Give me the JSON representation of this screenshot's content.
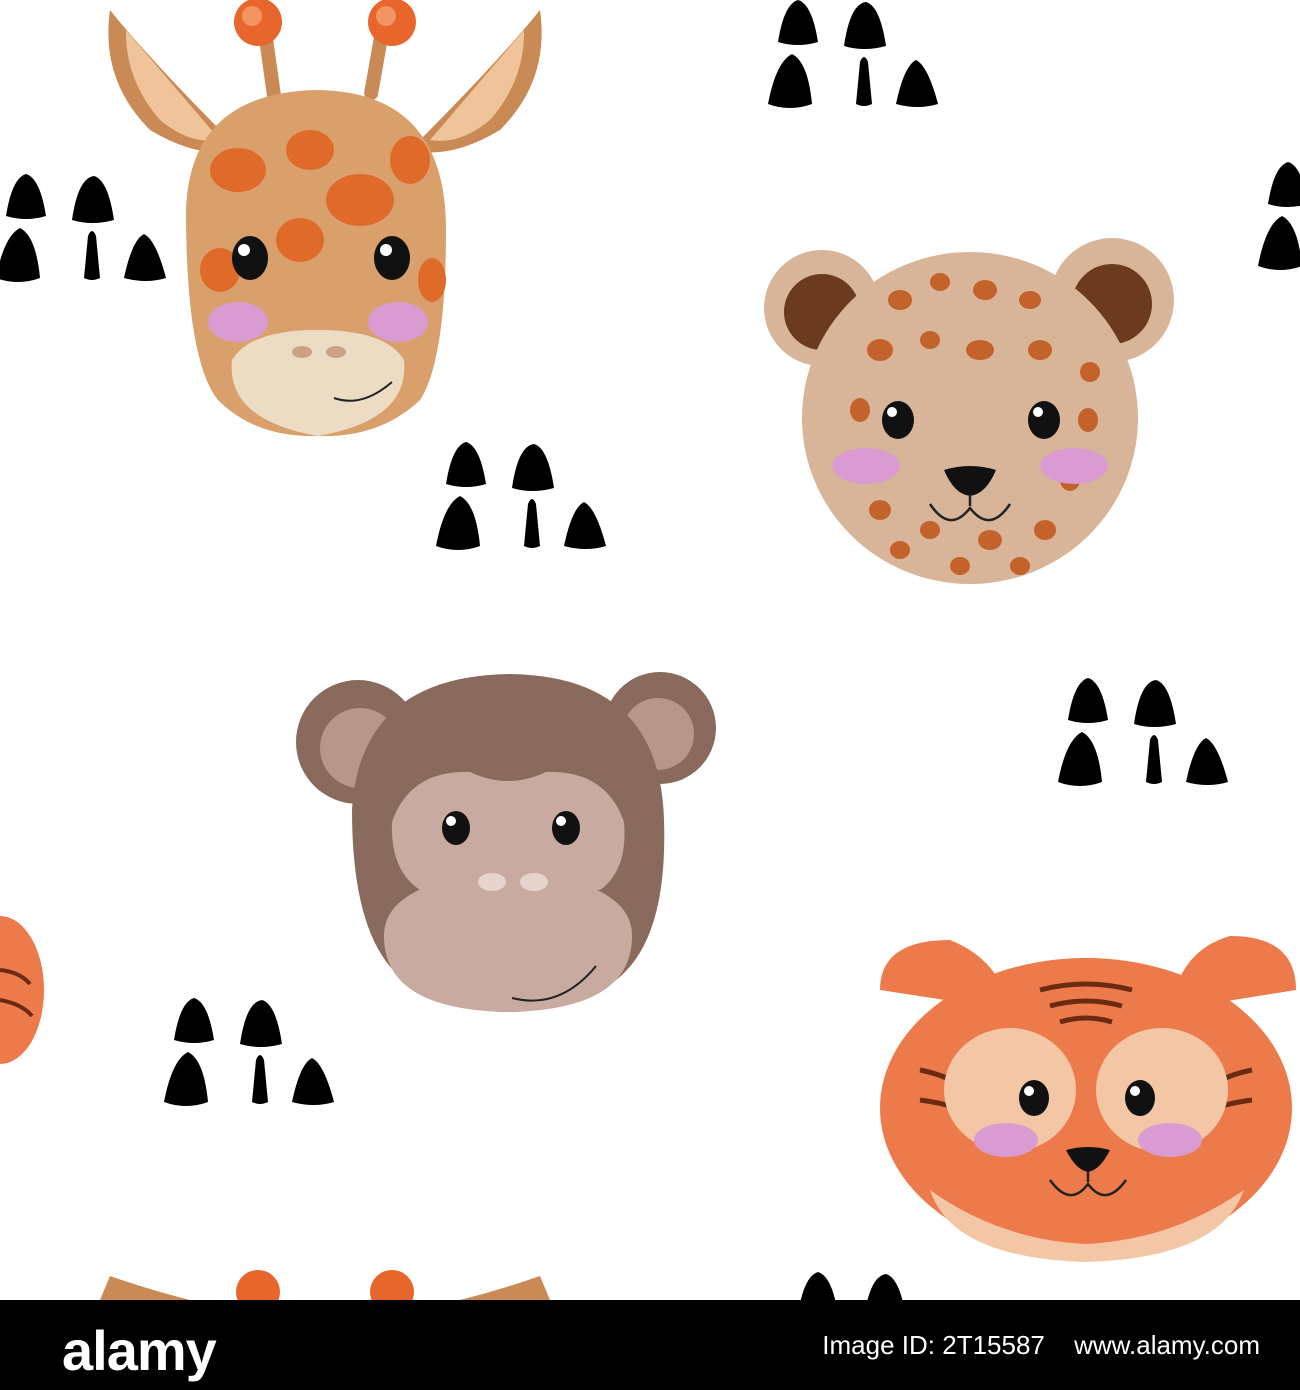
{
  "footer": {
    "brand": "alamy",
    "image_id_label": "Image ID: 2T15587",
    "site": "www.alamy.com"
  },
  "artwork": {
    "subjects": [
      "giraffe-head",
      "leopard-head",
      "monkey-head",
      "tiger-head",
      "tiger-head-partial",
      "giraffe-head-partial"
    ],
    "ornament": "black-triangle-cluster",
    "colors": {
      "background": "#ffffff",
      "giraffe_base": "#d9a06c",
      "giraffe_spots": "#e06a2a",
      "leopard_base": "#d8b598",
      "leopard_spots": "#c4622c",
      "monkey_base": "#8a6a5c",
      "monkey_face": "#c8aaa0",
      "tiger_base": "#ec7a4a",
      "tiger_face": "#f3c7a6",
      "blush": "#d99bd1",
      "ink": "#000000"
    }
  }
}
